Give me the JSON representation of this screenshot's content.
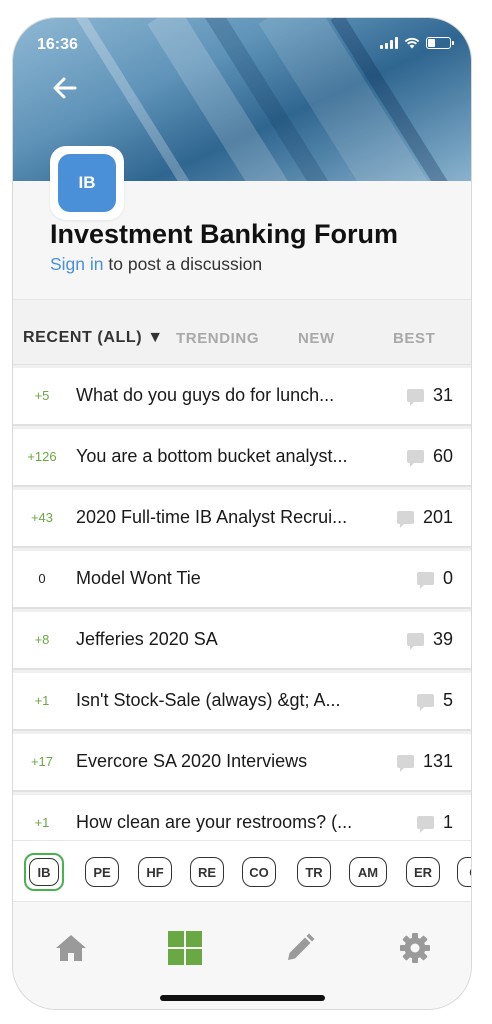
{
  "status_bar": {
    "time": "16:36"
  },
  "forum": {
    "logo_text": "IB",
    "title": "Investment Banking Forum",
    "sign_in_link": "Sign in",
    "sign_in_suffix": " to post a discussion"
  },
  "tabs": [
    {
      "label": "RECENT (ALL) ▼",
      "active": true
    },
    {
      "label": "TRENDING",
      "active": false
    },
    {
      "label": "NEW",
      "active": false
    },
    {
      "label": "BEST",
      "active": false
    }
  ],
  "threads": [
    {
      "score": "+5",
      "title": "What do you guys do for lunch...",
      "comments": "31"
    },
    {
      "score": "+126",
      "title": "You are a bottom bucket analyst...",
      "comments": "60"
    },
    {
      "score": "+43",
      "title": "2020 Full-time IB Analyst Recrui...",
      "comments": "201"
    },
    {
      "score": "0",
      "title": "Model Wont Tie",
      "comments": "0"
    },
    {
      "score": "+8",
      "title": "Jefferies 2020 SA",
      "comments": "39"
    },
    {
      "score": "+1",
      "title": "Isn't Stock-Sale (always) &gt; A...",
      "comments": "5"
    },
    {
      "score": "+17",
      "title": "Evercore SA 2020 Interviews",
      "comments": "131"
    },
    {
      "score": "+1",
      "title": "How clean are your restrooms? (...",
      "comments": "1"
    }
  ],
  "forum_chips": [
    "IB",
    "PE",
    "HF",
    "RE",
    "CO",
    "TR",
    "AM",
    "ER",
    "C"
  ],
  "active_chip": "IB",
  "tab_bar": {
    "items": [
      "home-icon",
      "grid-icon",
      "pencil-icon",
      "gear-icon"
    ],
    "active": "grid-icon"
  },
  "colors": {
    "accent_blue": "#4a90d9",
    "positive_green": "#6aa843",
    "active_green": "#4caf50",
    "icon_gray": "#9a9a9a"
  }
}
